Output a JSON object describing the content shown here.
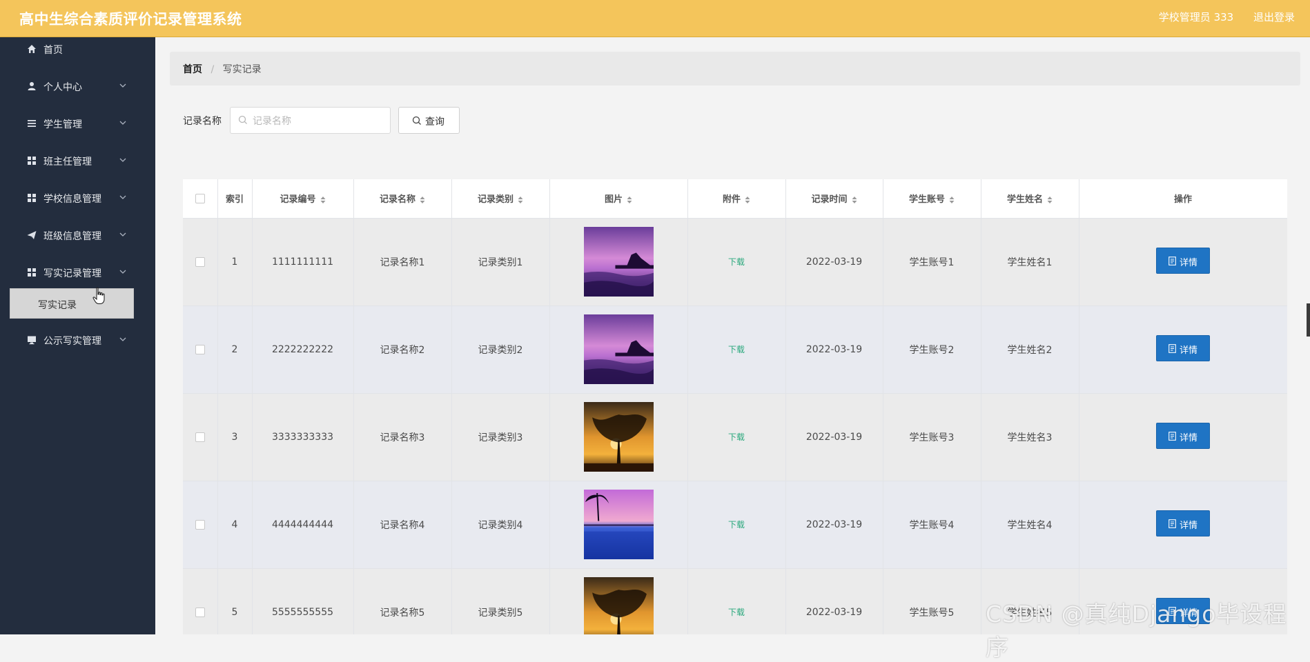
{
  "header": {
    "app_title": "高中生综合素质评价记录管理系统",
    "user_name": "学校管理员 333",
    "logout_label": "退出登录"
  },
  "sidebar": {
    "items": [
      {
        "label": "首页",
        "icon": "home-icon"
      },
      {
        "label": "个人中心",
        "icon": "person-icon"
      },
      {
        "label": "学生管理",
        "icon": "list-icon"
      },
      {
        "label": "班主任管理",
        "icon": "grid-icon"
      },
      {
        "label": "学校信息管理",
        "icon": "grid-icon"
      },
      {
        "label": "班级信息管理",
        "icon": "send-icon"
      },
      {
        "label": "写实记录管理",
        "icon": "grid-icon"
      },
      {
        "label": "公示写实管理",
        "icon": "monitor-icon"
      }
    ],
    "submenu_label": "写实记录"
  },
  "breadcrumb": {
    "home": "首页",
    "separator": "/",
    "current": "写实记录"
  },
  "search": {
    "label": "记录名称",
    "placeholder": "记录名称",
    "value": "",
    "query_label": "查询"
  },
  "table": {
    "headers": [
      "索引",
      "记录编号",
      "记录名称",
      "记录类别",
      "图片",
      "附件",
      "记录时间",
      "学生账号",
      "学生姓名",
      "操作"
    ],
    "download_label": "下载",
    "detail_label": "详情",
    "rows": [
      {
        "index": "1",
        "record_no": "1111111111",
        "name": "记录名称1",
        "category": "记录类别1",
        "image": "purple-sunset",
        "time": "2022-03-19",
        "account": "学生账号1",
        "student": "学生姓名1"
      },
      {
        "index": "2",
        "record_no": "2222222222",
        "name": "记录名称2",
        "category": "记录类别2",
        "image": "purple-sunset",
        "time": "2022-03-19",
        "account": "学生账号2",
        "student": "学生姓名2"
      },
      {
        "index": "3",
        "record_no": "3333333333",
        "name": "记录名称3",
        "category": "记录类别3",
        "image": "tree-sunset",
        "time": "2022-03-19",
        "account": "学生账号3",
        "student": "学生姓名3"
      },
      {
        "index": "4",
        "record_no": "4444444444",
        "name": "记录名称4",
        "category": "记录类别4",
        "image": "palm-pool",
        "time": "2022-03-19",
        "account": "学生账号4",
        "student": "学生姓名4"
      },
      {
        "index": "5",
        "record_no": "5555555555",
        "name": "记录名称5",
        "category": "记录类别5",
        "image": "tree-sunset",
        "time": "2022-03-19",
        "account": "学生账号5",
        "student": "学生姓名5"
      }
    ]
  },
  "watermark": "CSDN @真纯Django毕设程序",
  "colors": {
    "header_bg": "#f4c55b",
    "sidebar_bg": "#232d3e",
    "primary_button": "#1f74c4",
    "download_link": "#2aa87c"
  }
}
